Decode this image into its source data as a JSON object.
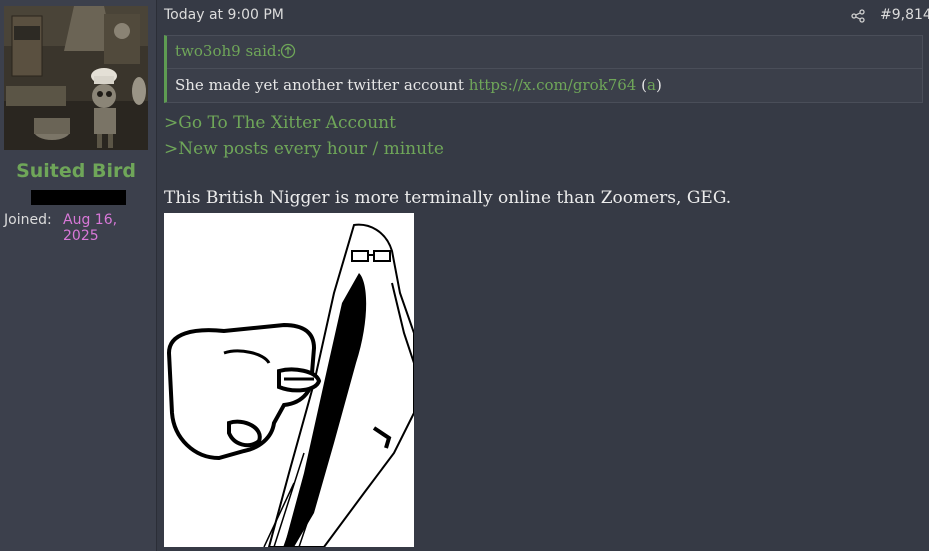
{
  "user": {
    "name": "Suited Bird",
    "joined_label": "Joined:",
    "joined_value": "Aug 16, 2025"
  },
  "post": {
    "date": "Today at 9:00 PM",
    "number": "#9,814",
    "quote": {
      "author": "two3oh9 said:",
      "text_before": "She made yet another twitter account ",
      "link": "https://x.com/grok764",
      "paren_open": " (",
      "archive_link": "a",
      "paren_close": ")"
    },
    "greentext": [
      ">Go To The Xitter Account",
      ">New posts every hour / minute"
    ],
    "body": "This British Nigger is more terminally online than Zoomers, GEG."
  },
  "icons": {
    "share": "share-icon",
    "quote_jump": "arrow-up-circle-icon"
  },
  "colors": {
    "accent_green": "#6fa659",
    "joined_pink": "#d878d8",
    "background": "#363a45"
  }
}
